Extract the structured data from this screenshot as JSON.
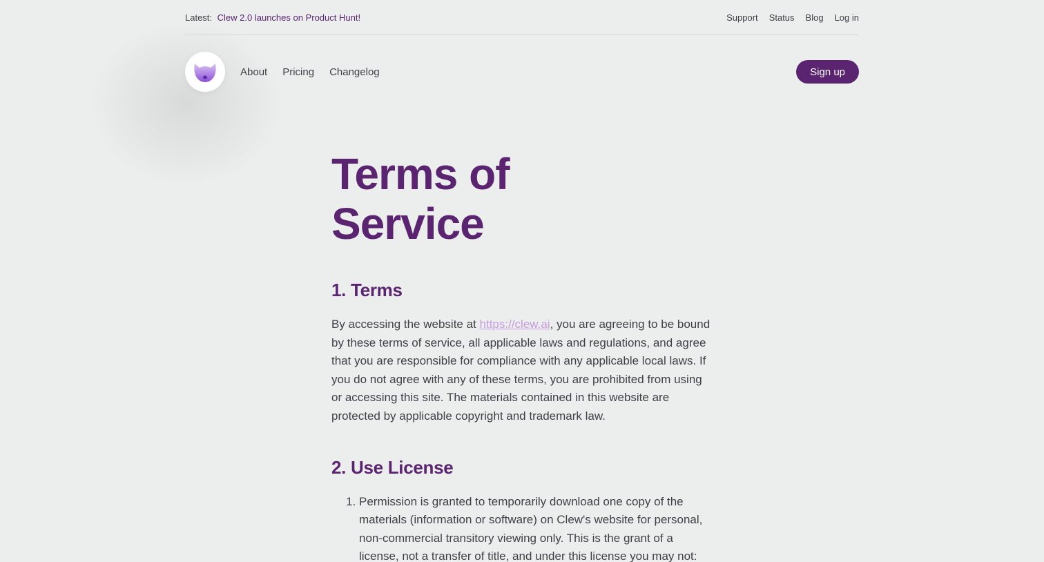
{
  "announcement": {
    "prefix": "Latest:",
    "link_text": "Clew 2.0 launches on Product Hunt!"
  },
  "top_links": [
    "Support",
    "Status",
    "Blog",
    "Log in"
  ],
  "nav": {
    "logo_icon": "cat-face-logo-icon",
    "links": [
      "About",
      "Pricing",
      "Changelog"
    ],
    "signup_label": "Sign up"
  },
  "colors": {
    "brand": "#5b2470",
    "link": "#c69be0",
    "background": "#eceeed"
  },
  "page": {
    "title_line1": "Terms of",
    "title_line2": "Service"
  },
  "sections": [
    {
      "heading": "1. Terms",
      "para_before_link": "By accessing the website at ",
      "link": "https://clew.ai",
      "para_after_link": ", you are agreeing to be bound by these terms of service, all applicable laws and regulations, and agree that you are responsible for compliance with any applicable local laws. If you do not agree with any of these terms, you are prohibited from using or accessing this site. The materials contained in this website are protected by applicable copyright and trademark law."
    },
    {
      "heading": "2. Use License",
      "items": [
        "Permission is granted to temporarily download one copy of the materials (information or software) on Clew's website for personal, non-commercial transitory viewing only. This is the grant of a license, not a transfer of title, and under this license you may not: modify or copy the materials; use the materials for"
      ]
    }
  ]
}
